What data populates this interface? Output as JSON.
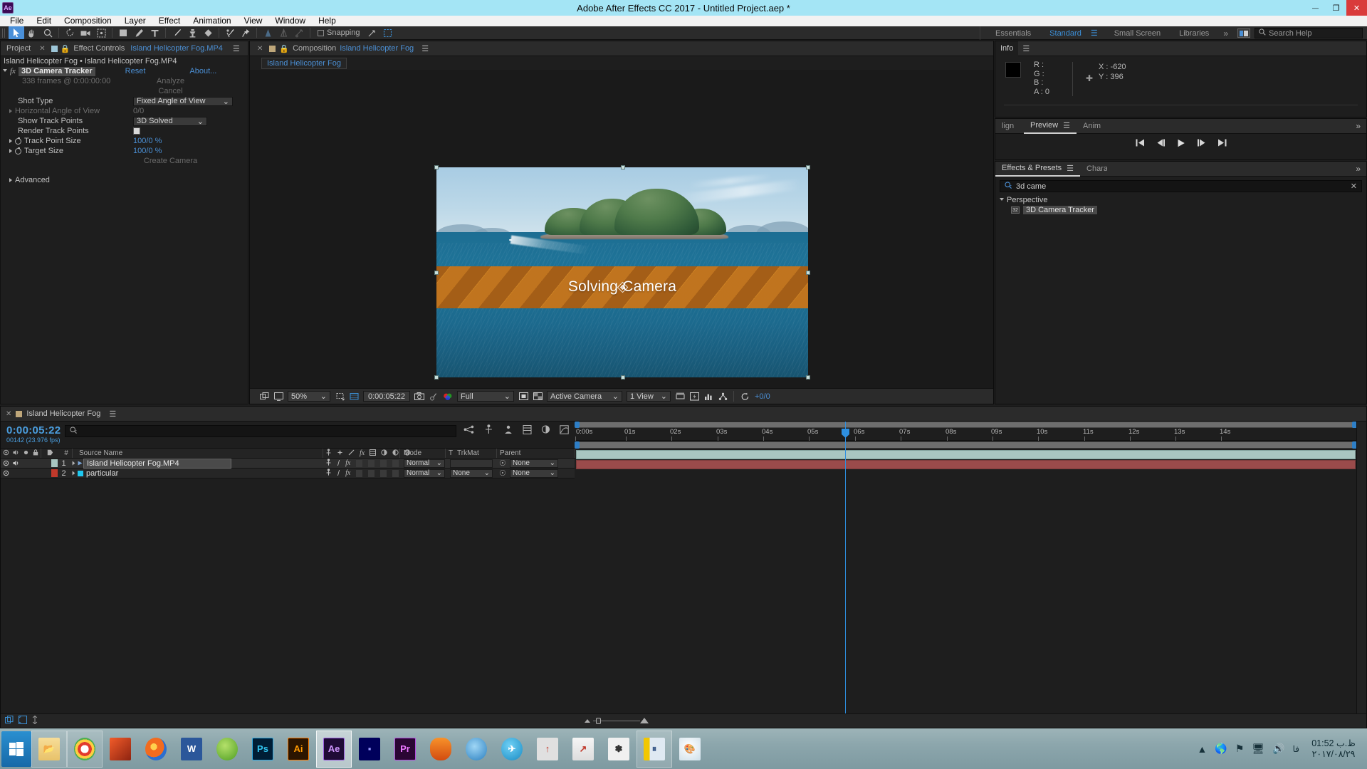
{
  "window": {
    "title": "Adobe After Effects CC 2017 - Untitled Project.aep *",
    "logo": "Ae",
    "minimize": "minimize-icon",
    "maximize": "maximize-icon",
    "close": "close-icon"
  },
  "menubar": {
    "items": [
      "File",
      "Edit",
      "Composition",
      "Layer",
      "Effect",
      "Animation",
      "View",
      "Window",
      "Help"
    ]
  },
  "toolbar": {
    "snapping_label": "Snapping",
    "workspaces": [
      "Essentials",
      "Standard",
      "Small Screen",
      "Libraries"
    ],
    "selected_workspace": "Standard",
    "overflow": "»",
    "search_help_placeholder": "Search Help"
  },
  "effect_controls": {
    "tab_project": "Project",
    "tab_label": "Effect Controls",
    "tab_target": "Island Helicopter Fog.MP4",
    "breadcrumb": "Island Helicopter Fog • Island Helicopter Fog.MP4",
    "effect_name": "3D Camera Tracker",
    "reset_label": "Reset",
    "about_label": "About...",
    "frames_info": "338 frames @ 0:00:00:00",
    "analyze_label": "Analyze",
    "cancel_label": "Cancel",
    "create_camera_label": "Create Camera",
    "advanced_label": "Advanced",
    "properties": [
      {
        "label": "Shot Type",
        "value": "Fixed Angle of View",
        "type": "dropdown",
        "disabled": false
      },
      {
        "label": "Horizontal Angle of View",
        "value": "0/0",
        "type": "text",
        "disabled": true
      },
      {
        "label": "Show Track Points",
        "value": "3D Solved",
        "type": "dropdown",
        "disabled": false
      },
      {
        "label": "Render Track Points",
        "value": "",
        "type": "checkbox",
        "disabled": false
      },
      {
        "label": "Track Point Size",
        "value": "100/0 %",
        "type": "stopwatch",
        "disabled": false
      },
      {
        "label": "Target Size",
        "value": "100/0 %",
        "type": "stopwatch",
        "disabled": false
      }
    ]
  },
  "composition": {
    "tab_label": "Composition",
    "tab_name": "Island Helicopter Fog",
    "breadcrumb_chip": "Island Helicopter Fog",
    "overlay_text": "Solving Camera",
    "footer": {
      "zoom": "50%",
      "time": "0:00:05:22",
      "resolution": "Full",
      "view_camera": "Active Camera",
      "view_count": "1 View",
      "exposure": "+0/0"
    }
  },
  "info_panel": {
    "title": "Info",
    "r_label": "R :",
    "g_label": "G :",
    "b_label": "B :",
    "a_label": "A : 0",
    "x_label": "X : -620",
    "y_label": "Y : 396"
  },
  "preview_panel": {
    "tabs": [
      "lign",
      "Preview",
      "Anim"
    ],
    "selected": "Preview",
    "overflow": "»",
    "controls": [
      "first-frame",
      "prev-frame",
      "play",
      "next-frame",
      "last-frame"
    ]
  },
  "effects_panel": {
    "tabs": [
      "Effects & Presets",
      "Chara"
    ],
    "selected": "Effects & Presets",
    "overflow": "»",
    "search_value": "3d came",
    "category": "Perspective",
    "items": [
      {
        "name": "3D Camera Tracker",
        "badge": "32",
        "selected": true
      }
    ]
  },
  "timeline": {
    "tab_name": "Island Helicopter Fog",
    "current_time": "0:00:05:22",
    "frame_info": "00142 (23.976 fps)",
    "columns": {
      "num": "#",
      "source_name": "Source Name",
      "mode": "Mode",
      "t": "T",
      "trkmat": "TrkMat",
      "parent": "Parent"
    },
    "layers": [
      {
        "index": "1",
        "name": "Island Helicopter Fog.MP4",
        "mode": "Normal",
        "trkmat": "",
        "parent": "None",
        "color": "#a9c6c1",
        "bar_color": "#a9c6c1",
        "selected": true,
        "has_audio": true
      },
      {
        "index": "2",
        "name": "particular",
        "mode": "Normal",
        "trkmat": "None",
        "parent": "None",
        "color": "#c0392b",
        "bar_color": "#9a4b4b",
        "selected": false,
        "has_audio": false
      }
    ],
    "ruler_ticks": [
      "0:00s",
      "01s",
      "02s",
      "03s",
      "04s",
      "05s",
      "06s",
      "07s",
      "08s",
      "09s",
      "10s",
      "11s",
      "12s",
      "13s",
      "14s"
    ],
    "playhead_time_index": 5.9
  },
  "taskbar": {
    "start": "windows-start",
    "apps": [
      {
        "name": "file-explorer",
        "label": "",
        "color": "#f3c969",
        "glyph": "📁"
      },
      {
        "name": "google-chrome",
        "label": "",
        "color": "#ffffff",
        "glyph": ""
      },
      {
        "name": "utorrent",
        "label": "",
        "color": "#b03a2e",
        "glyph": ""
      },
      {
        "name": "mozilla-firefox",
        "label": "",
        "color": "#e8751a",
        "glyph": ""
      },
      {
        "name": "microsoft-word",
        "label": "W",
        "color": "#2b579a",
        "glyph": "W"
      },
      {
        "name": "green-leaf-app",
        "label": "",
        "color": "#7ac143",
        "glyph": ""
      },
      {
        "name": "adobe-photoshop",
        "label": "Ps",
        "color": "#001e36",
        "glyph": "Ps"
      },
      {
        "name": "adobe-illustrator",
        "label": "Ai",
        "color": "#330000",
        "glyph": "Ai"
      },
      {
        "name": "adobe-after-effects",
        "label": "Ae",
        "color": "#1f0b36",
        "glyph": "Ae",
        "active": true
      },
      {
        "name": "adobe-audition",
        "label": "",
        "color": "#00005b",
        "glyph": ""
      },
      {
        "name": "adobe-premiere-pro",
        "label": "Pr",
        "color": "#2a0634",
        "glyph": "Pr"
      },
      {
        "name": "orange-app",
        "label": "",
        "color": "#e8720c",
        "glyph": ""
      },
      {
        "name": "blue-circle-app",
        "label": "",
        "color": "#2e86c1",
        "glyph": ""
      },
      {
        "name": "telegram",
        "label": "",
        "color": "#2aabee",
        "glyph": ""
      },
      {
        "name": "upload-app",
        "label": "",
        "color": "#d0cfcf",
        "glyph": ""
      },
      {
        "name": "red-chart-app",
        "label": "",
        "color": "#c0392b",
        "glyph": ""
      },
      {
        "name": "fan-app",
        "label": "",
        "color": "#4f4f4f",
        "glyph": ""
      },
      {
        "name": "media-player",
        "label": "",
        "color": "#f2c700",
        "glyph": ""
      },
      {
        "name": "paint-app",
        "label": "",
        "color": "#dfe8ee",
        "glyph": ""
      }
    ],
    "tray": {
      "show_hidden": "chevron-up-icon",
      "network": "network-icon",
      "flag": "action-center-icon",
      "monitor": "display-icon",
      "volume": "volume-icon",
      "language": "فا",
      "time": "01:52 ظ.ب",
      "date": "٢٠١٧/٠٨/٢٩"
    }
  },
  "colors": {
    "accent_blue": "#4b8fd4",
    "title_bar": "#a4e5f5",
    "panel_bg": "#1e1e1e",
    "tab_bg": "#2b2b2b",
    "stripe_orange": "#c5741b"
  }
}
